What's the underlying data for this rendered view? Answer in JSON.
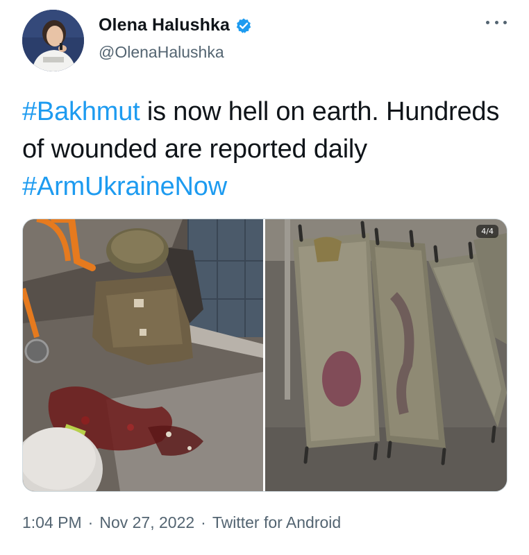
{
  "author": {
    "display_name": "Olena Halushka",
    "handle": "@OlenaHalushka",
    "verified": true
  },
  "tweet": {
    "segments": [
      {
        "text": "#Bakhmut",
        "type": "hashtag"
      },
      {
        "text": " is now hell on earth. Hundreds of wounded are reported daily ",
        "type": "text"
      },
      {
        "text": "#ArmUkraineNow",
        "type": "hashtag"
      }
    ]
  },
  "media": {
    "counter": "4/4",
    "photos": [
      {
        "icon": "photo-body-armor-blood"
      },
      {
        "icon": "photo-stretchers"
      }
    ]
  },
  "meta": {
    "time": "1:04 PM",
    "date": "Nov 27, 2022",
    "source": "Twitter for Android",
    "separator": "·"
  },
  "colors": {
    "link": "#1d9bf0",
    "secondary": "#536471",
    "text": "#0f1419",
    "verified": "#1d9bf0"
  }
}
